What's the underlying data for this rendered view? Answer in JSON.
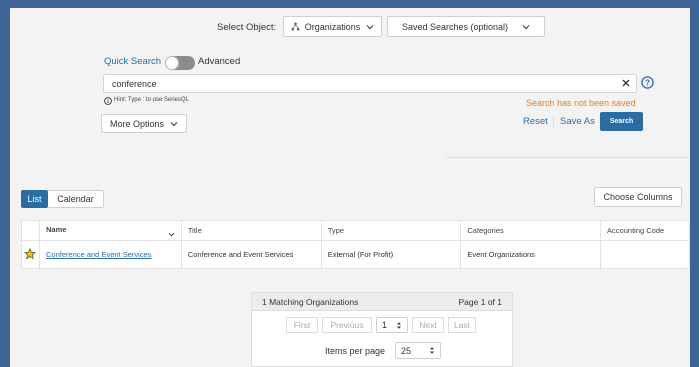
{
  "header": {
    "select_object_label": "Select Object:",
    "object_select_value": "Organizations",
    "saved_searches_value": "Saved Searches (optional)"
  },
  "search": {
    "quick_search_label": "Quick Search",
    "advanced_label": "Advanced",
    "query_value": "conference",
    "hint": "Hint: Type : to use SeriesQL",
    "not_saved_message": "Search has not been saved",
    "more_options_label": "More Options",
    "reset_label": "Reset",
    "save_as_label": "Save As",
    "search_button_label": "Search"
  },
  "view_tabs": {
    "list_label": "List",
    "calendar_label": "Calendar"
  },
  "choose_columns_label": "Choose Columns",
  "table": {
    "columns": [
      "Name",
      "Title",
      "Type",
      "Categories",
      "Accounting Code"
    ],
    "rows": [
      {
        "name": "Conference and Event Services",
        "title": "Conference and Event Services",
        "type": "External (For Profit)",
        "categories": "Event Organizations",
        "accounting_code": ""
      }
    ]
  },
  "pagination": {
    "matching": "1 Matching Organizations",
    "page_info": "Page 1 of 1",
    "first_label": "First",
    "previous_label": "Previous",
    "page_value": "1",
    "next_label": "Next",
    "last_label": "Last",
    "items_per_page_label": "Items per page",
    "items_per_page_value": "25"
  },
  "colors": {
    "frame": "#3d6494",
    "accent": "#2b6ca3",
    "warning": "#e67e22",
    "star": "#f1c40f"
  },
  "icons": [
    "hierarchy-icon",
    "chevron-down-icon",
    "close-icon",
    "help-circle-icon",
    "info-icon",
    "star-icon",
    "spinner-icon"
  ]
}
